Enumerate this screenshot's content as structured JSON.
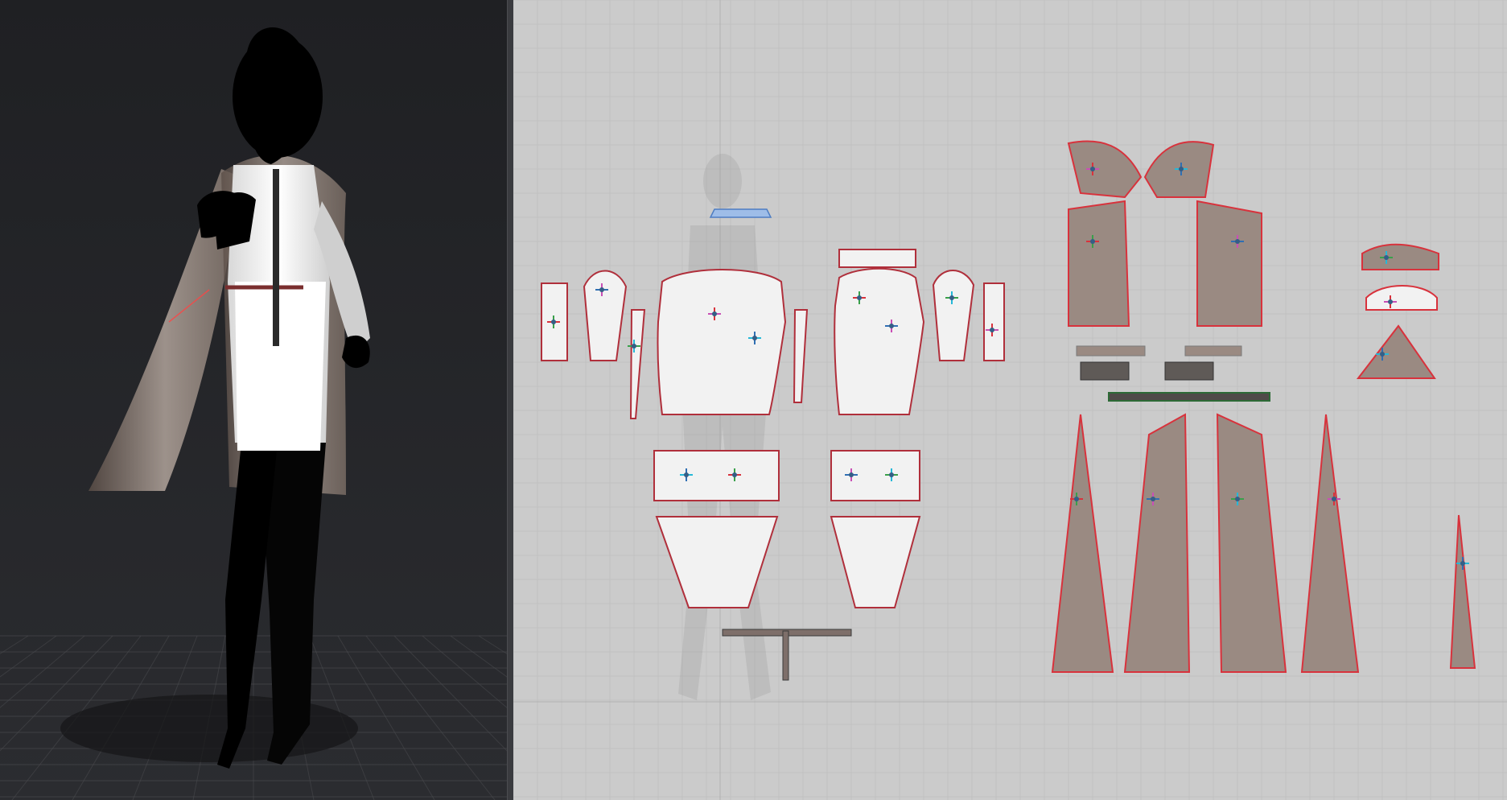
{
  "app": {
    "views": {
      "left": "3d-viewport",
      "right": "2d-pattern-window"
    }
  },
  "colors": {
    "background_3d": "#202124",
    "floor_grid": "#4a4b4f",
    "background_2d": "#cbcbcb",
    "pattern_white": "#f2f2f2",
    "pattern_brown": "#9a8a82",
    "accent_red": "#d8323c",
    "accent_blue": "#2f6fb3",
    "accent_green": "#39a04a",
    "accent_magenta": "#c94fb5",
    "accent_cyan": "#25b8d8"
  },
  "icons": {
    "avatar": "avatar-silhouette-icon",
    "garment": "garment-pattern-icon"
  }
}
